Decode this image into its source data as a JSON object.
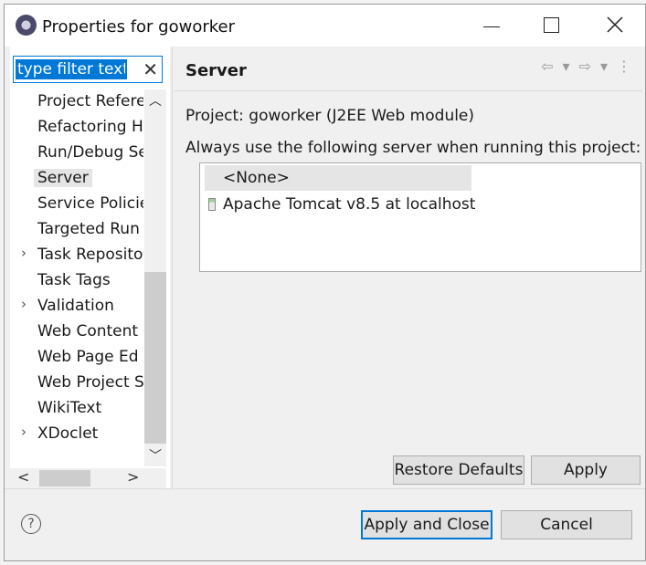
{
  "window": {
    "title": "Properties for goworker",
    "minimize_icon": "minimize-icon",
    "maximize_icon": "maximize-icon",
    "close_icon": "close-icon"
  },
  "filter": {
    "placeholder": "type filter text",
    "clear_icon": "✕"
  },
  "tree": {
    "items": [
      {
        "label": "Project Refere",
        "expandable": false,
        "selected": false
      },
      {
        "label": "Refactoring H",
        "expandable": false,
        "selected": false
      },
      {
        "label": "Run/Debug Se",
        "expandable": false,
        "selected": false
      },
      {
        "label": "Server",
        "expandable": false,
        "selected": true
      },
      {
        "label": "Service Policie",
        "expandable": false,
        "selected": false
      },
      {
        "label": "Targeted Run",
        "expandable": false,
        "selected": false
      },
      {
        "label": "Task Reposito",
        "expandable": true,
        "selected": false
      },
      {
        "label": "Task Tags",
        "expandable": false,
        "selected": false
      },
      {
        "label": "Validation",
        "expandable": true,
        "selected": false
      },
      {
        "label": "Web Content",
        "expandable": false,
        "selected": false
      },
      {
        "label": "Web Page Ed",
        "expandable": false,
        "selected": false
      },
      {
        "label": "Web Project S",
        "expandable": false,
        "selected": false
      },
      {
        "label": "WikiText",
        "expandable": false,
        "selected": false
      },
      {
        "label": "XDoclet",
        "expandable": true,
        "selected": false
      }
    ]
  },
  "page": {
    "heading": "Server",
    "project_line": "Project: goworker (J2EE Web module)",
    "instruction": "Always use the following server when running this project:",
    "servers": [
      {
        "label": "<None>",
        "selected": true,
        "icon": ""
      },
      {
        "label": "Apache Tomcat v8.5  at localhost",
        "selected": false,
        "icon": "server-icon"
      }
    ],
    "restore_defaults": "Restore Defaults",
    "apply": "Apply"
  },
  "footer": {
    "help": "?",
    "apply_and_close": "Apply and Close",
    "cancel": "Cancel"
  }
}
